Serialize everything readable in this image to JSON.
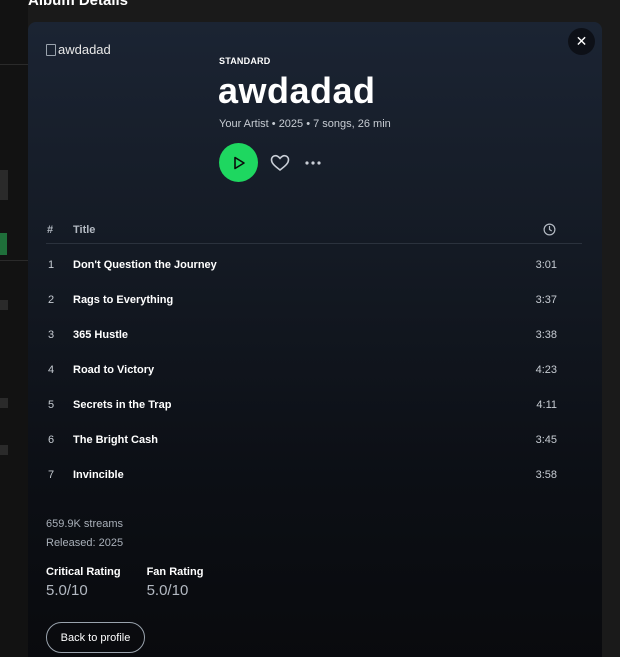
{
  "modal": {
    "heading": "Album Details",
    "close_glyph": "✕",
    "close_icon": "close-icon"
  },
  "album": {
    "cover_alt": "awdadad",
    "type": "STANDARD",
    "title": "awdadad",
    "meta": "Your Artist • 2025 • 7 songs, 26 min"
  },
  "actions": {
    "play_icon": "play-icon",
    "like_icon": "heart-icon",
    "more_icon": "more-icon",
    "accent_color": "#1ed760"
  },
  "tracklist": {
    "headers": {
      "number": "#",
      "title": "Title",
      "duration_icon": "clock-icon"
    },
    "tracks": [
      {
        "n": "1",
        "title": "Don't Question the Journey",
        "duration": "3:01"
      },
      {
        "n": "2",
        "title": "Rags to Everything",
        "duration": "3:37"
      },
      {
        "n": "3",
        "title": "365 Hustle",
        "duration": "3:38"
      },
      {
        "n": "4",
        "title": "Road to Victory",
        "duration": "4:23"
      },
      {
        "n": "5",
        "title": "Secrets in the Trap",
        "duration": "4:11"
      },
      {
        "n": "6",
        "title": "The Bright Cash",
        "duration": "3:45"
      },
      {
        "n": "7",
        "title": "Invincible",
        "duration": "3:58"
      }
    ]
  },
  "stats": {
    "streams": "659.9K streams",
    "released": "Released: 2025"
  },
  "ratings": {
    "critical_label": "Critical Rating",
    "critical_value": "5.0/10",
    "fan_label": "Fan Rating",
    "fan_value": "5.0/10"
  },
  "footer": {
    "back_label": "Back to profile"
  }
}
